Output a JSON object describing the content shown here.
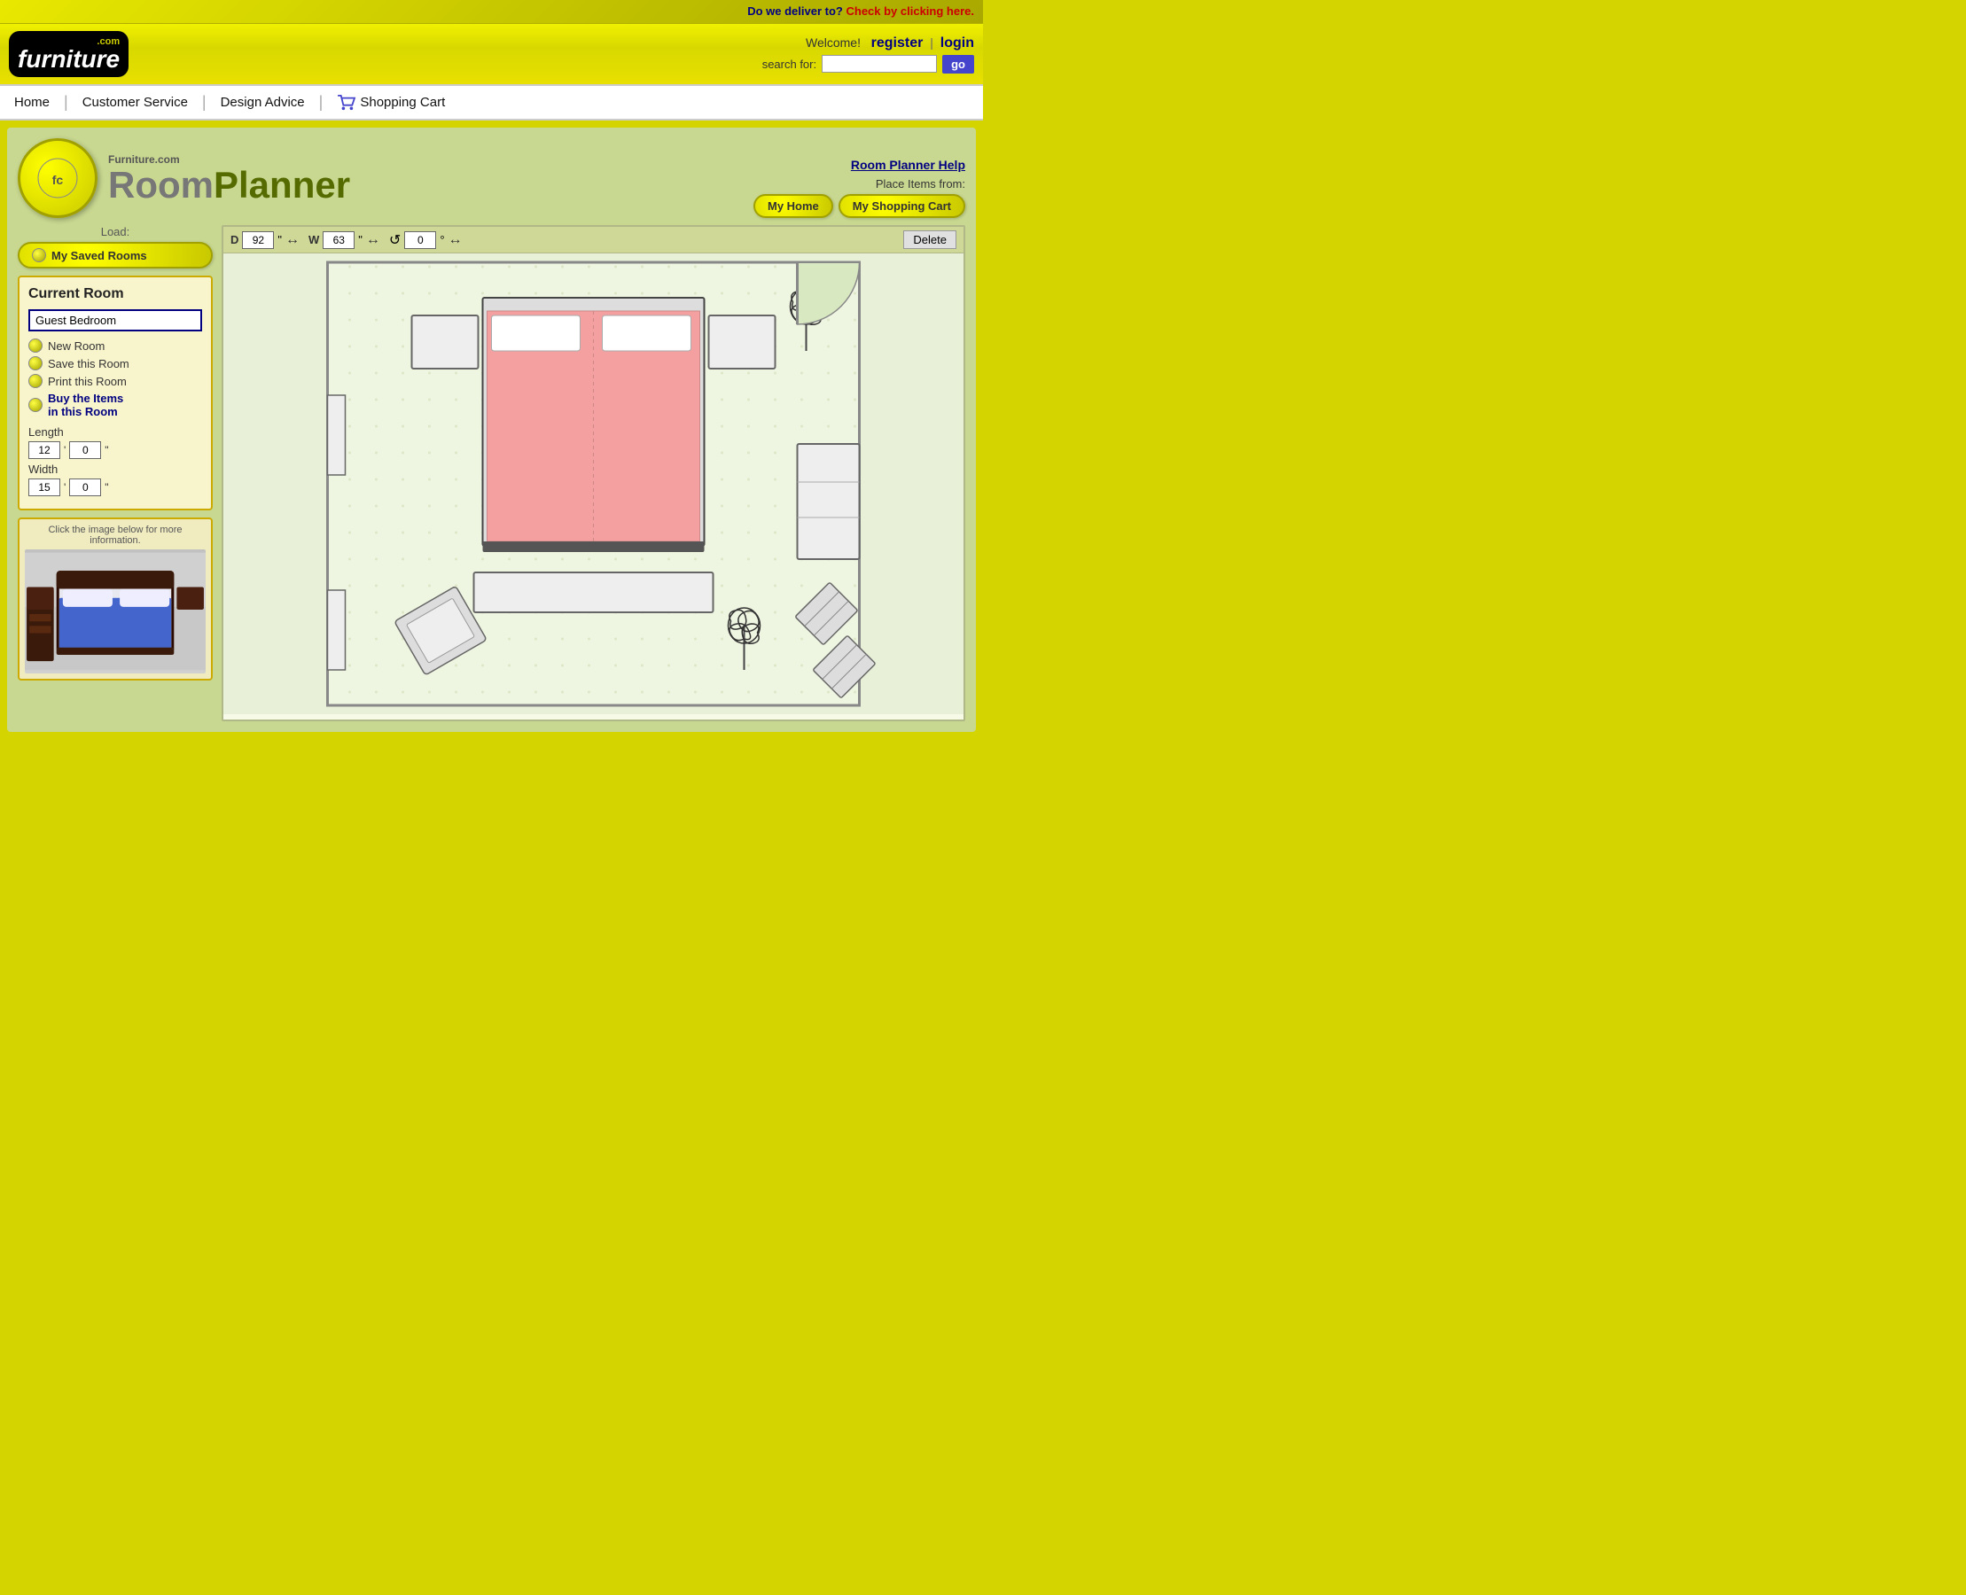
{
  "topbar": {
    "delivery_question": "Do we deliver to?",
    "delivery_link": "Check by clicking here."
  },
  "header": {
    "logo_com": ".com",
    "logo_furniture": "furniture",
    "welcome": "Welcome!",
    "register": "register",
    "pipe": "|",
    "login": "login",
    "search_label": "search for:",
    "search_placeholder": "",
    "search_go": "go"
  },
  "nav": {
    "items": [
      "Home",
      "Customer Service",
      "Design Advice",
      "Shopping Cart"
    ]
  },
  "planner": {
    "help_label": "Room Planner Help",
    "place_label": "Place Items from:",
    "my_home_btn": "My Home",
    "my_cart_btn": "My Shopping Cart",
    "logo_site": "Furniture.com",
    "logo_room": "Room",
    "logo_planner": "Planner"
  },
  "left_panel": {
    "load_label": "Load:",
    "saved_rooms_btn": "My Saved Rooms",
    "current_room_title": "Current Room",
    "room_name": "Guest Bedroom",
    "new_room": "New Room",
    "save_room": "Save this Room",
    "print_room": "Print this Room",
    "buy_items": "Buy the Items\nin this Room",
    "length_label": "Length",
    "length_ft": "12",
    "length_in": "0",
    "width_label": "Width",
    "width_ft": "15",
    "width_in": "0",
    "image_hint": "Click the image below for more information."
  },
  "canvas": {
    "depth_label": "D",
    "depth_value": "92",
    "depth_unit": "\"",
    "width_label": "W",
    "width_value": "63",
    "width_unit": "\"",
    "rotation_label": "°",
    "rotation_value": "0",
    "delete_label": "Delete"
  }
}
